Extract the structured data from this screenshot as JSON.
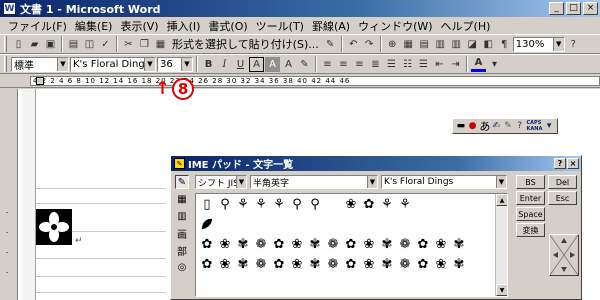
{
  "window": {
    "title": "文書 1 - Microsoft Word",
    "buttons": [
      "_",
      "□",
      "×"
    ]
  },
  "menu": [
    "ファイル(F)",
    "編集(E)",
    "表示(V)",
    "挿入(I)",
    "書式(O)",
    "ツール(T)",
    "罫線(A)",
    "ウィンドウ(W)",
    "ヘルプ(H)"
  ],
  "toolbar1": {
    "paste_format_label": "形式を選択して貼り付け(S)...",
    "zoom": "130%"
  },
  "toolbar2": {
    "style": "標準",
    "font": "K's Floral Dings",
    "size": "36",
    "bold": "B",
    "italic": "I",
    "underline": "U",
    "border_a": "A",
    "shade_a": "A"
  },
  "ruler": {
    "text": "4  2        2  4  6  8  10  12  14  16  18  20  22  24  26  28  30  32  34  36  38  40  42  44  46"
  },
  "callout": {
    "arrow": "↑",
    "number": "8"
  },
  "language_bar": {
    "label": "あ",
    "caps": "CAPS",
    "kana": "KANA"
  },
  "ime_pad": {
    "title": "IME パッド - 文字一覧",
    "help_button": "?",
    "close_button": "×",
    "charset_combo": "シフト JIS",
    "category_combo": "半角英字",
    "font_combo": "K's Floral Dings",
    "keys": {
      "bs": "BS",
      "del": "Del",
      "enter": "Enter",
      "esc": "Esc",
      "space": "Space",
      "convert": "変換"
    },
    "glyph_rows": [
      [
        "▯",
        "⚲",
        "⚘",
        "⚘",
        "⚘",
        "⚲",
        "⚲",
        "",
        "❀",
        "✿",
        "⚘",
        "⚘"
      ],
      [
        "",
        "",
        "",
        "",
        "",
        "",
        "",
        "",
        "",
        "",
        "",
        "",
        "",
        "",
        ""
      ],
      [
        "✿",
        "❀",
        "✾",
        "❁",
        "✿",
        "❀",
        "✾",
        "❁",
        "✿",
        "❀",
        "✾",
        "❁",
        "✿",
        "❀",
        "✾"
      ],
      [
        "✿",
        "❀",
        "✾",
        "❁",
        "✿",
        "❀",
        "✾",
        "❁",
        "✿",
        "❀",
        "✾",
        "❁",
        "✿",
        "❀",
        "✾"
      ]
    ]
  }
}
